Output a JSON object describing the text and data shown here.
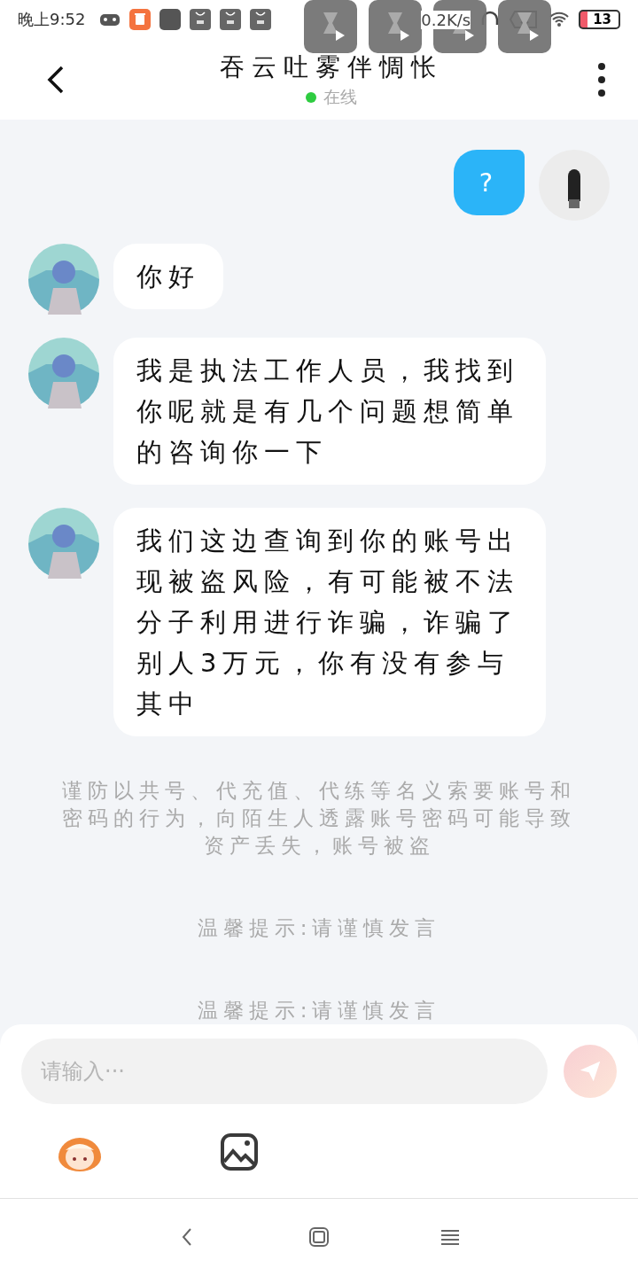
{
  "status_bar": {
    "time": "晚上9:52",
    "net_speed": "0.2K/s",
    "battery": "13"
  },
  "header": {
    "title": "吞云吐雾伴惆怅",
    "status": "在线",
    "online": true
  },
  "messages": [
    {
      "kind": "sent",
      "text": "?"
    },
    {
      "kind": "received",
      "text": "你好"
    },
    {
      "kind": "received",
      "text": "我是执法工作人员，我找到你呢就是有几个问题想简单的咨询你一下"
    },
    {
      "kind": "received",
      "text": "我们这边查询到你的账号出现被盗风险，有可能被不法分子利用进行诈骗，诈骗了别人3万元，你有没有参与其中"
    }
  ],
  "notices": [
    "谨防以共号、代充值、代练等名义索要账号和密码的行为，向陌生人透露账号密码可能导致资产丢失，账号被盗",
    "温馨提示:请谨慎发言",
    "温馨提示:请谨慎发言"
  ],
  "composer": {
    "placeholder": "请输入···"
  }
}
